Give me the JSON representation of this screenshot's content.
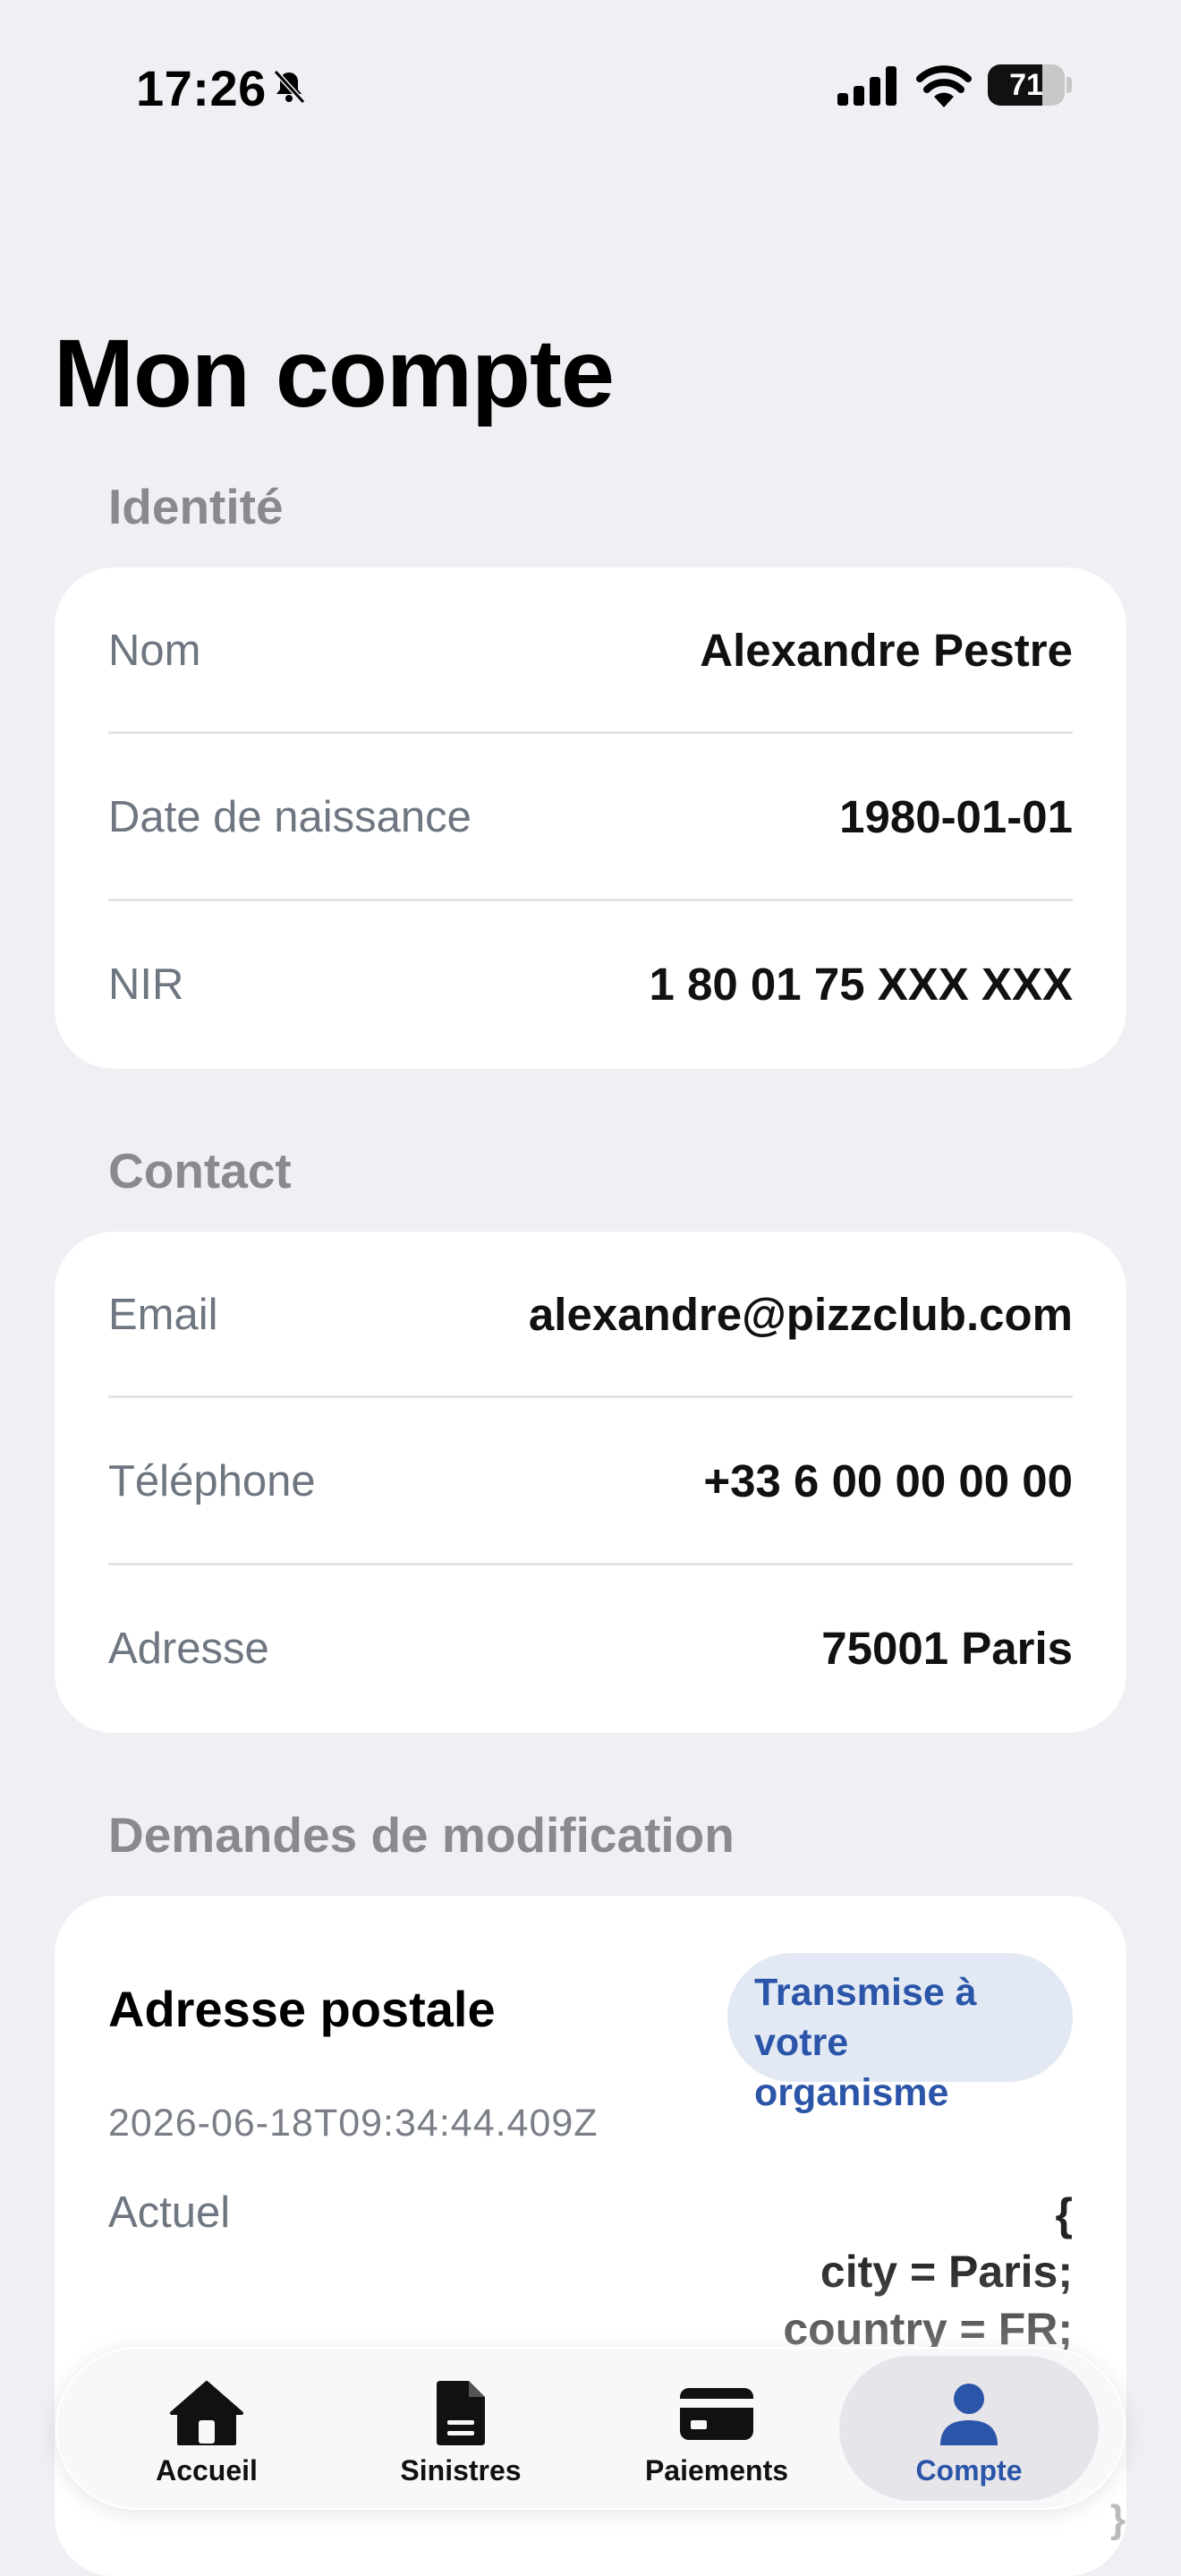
{
  "status_bar": {
    "time": "17:26",
    "battery": "71",
    "battery_level": 0.71
  },
  "page": {
    "title": "Mon compte"
  },
  "identity": {
    "header": "Identité",
    "rows": [
      {
        "label": "Nom",
        "value": "Alexandre Pestre"
      },
      {
        "label": "Date de naissance",
        "value": "1980-01-01"
      },
      {
        "label": "NIR",
        "value": "1 80 01 75 XXX XXX"
      }
    ]
  },
  "contact": {
    "header": "Contact",
    "rows": [
      {
        "label": "Email",
        "value": "alexandre@pizzclub.com"
      },
      {
        "label": "Téléphone",
        "value": "+33 6 00 00 00 00"
      },
      {
        "label": "Adresse",
        "value": "75001 Paris"
      }
    ]
  },
  "requests": {
    "header": "Demandes de modification",
    "items": [
      {
        "title": "Adresse postale",
        "status": "Transmise à votre organisme",
        "date": "2026-06-18T09:34:44.409Z",
        "current_label": "Actuel",
        "current_value": "{\ncity = Paris;\ncountry = FR;",
        "closing": "}"
      }
    ]
  },
  "tabbar": {
    "items": [
      {
        "label": "Accueil",
        "icon": "home-icon"
      },
      {
        "label": "Sinistres",
        "icon": "document-icon"
      },
      {
        "label": "Paiements",
        "icon": "credit-card-icon"
      },
      {
        "label": "Compte",
        "icon": "person-icon",
        "active": true
      }
    ]
  },
  "colors": {
    "accent": "#2b55a8",
    "background": "#efeff4",
    "badge_bg": "#e2e9f4"
  }
}
